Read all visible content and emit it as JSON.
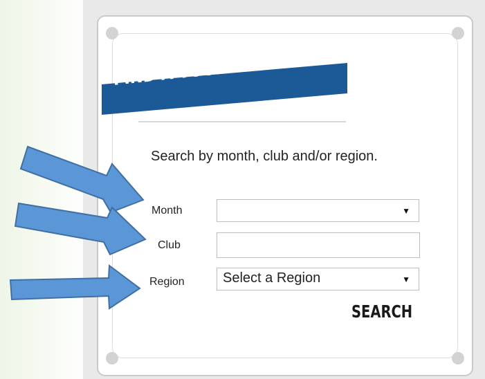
{
  "widget": {
    "title": "FIND A TOURNAMENT",
    "intro": "Search by month, club and/or region.",
    "fields": {
      "month": {
        "label": "Month",
        "value": ""
      },
      "club": {
        "label": "Club",
        "value": ""
      },
      "region": {
        "label": "Region",
        "value": "Select a Region"
      }
    },
    "search_label": "SEARCH",
    "dropdown_icon": "▼"
  },
  "colors": {
    "ribbon": "#1c5a97",
    "arrow": "#5b96d6",
    "arrow_outline": "#3f6fa3"
  }
}
